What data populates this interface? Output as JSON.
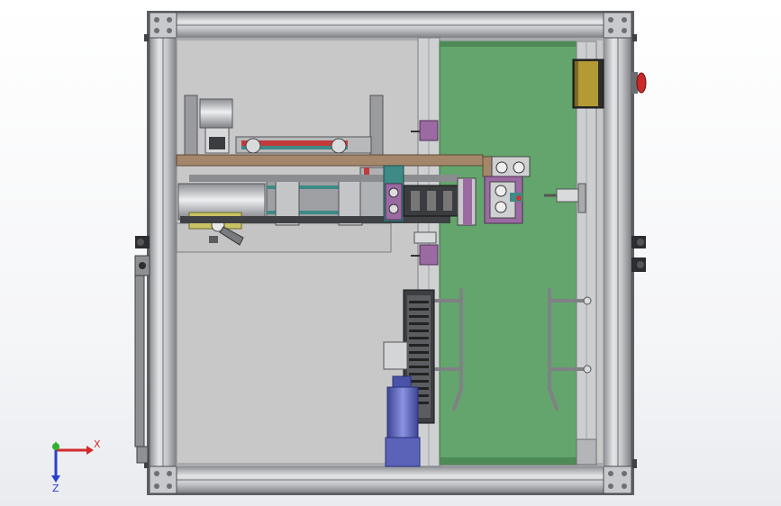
{
  "viewport": {
    "background_top": "#ffffff",
    "background_bottom": "#e9ebef"
  },
  "colors": {
    "frame_light": "#d9dadd",
    "frame_mid": "#b9bbbf",
    "frame_dark": "#6f7175",
    "panel_fill": "#c9c9c9",
    "conveyor_green": "#63a56c",
    "conveyor_green_dark": "#4e8a57",
    "wood_plate": "#a4876a",
    "motor_blue": "#6f79c9",
    "gearbox_yellow": "#c9c264",
    "purple_block": "#9b6aa3",
    "red_accent": "#c23a3a",
    "teal_accent": "#3d8a86"
  },
  "triad": {
    "x_label": "X",
    "z_label": "Z",
    "x_color": "#d22a2a",
    "y_color": "#2fb12f",
    "z_color": "#2a3fd2"
  }
}
